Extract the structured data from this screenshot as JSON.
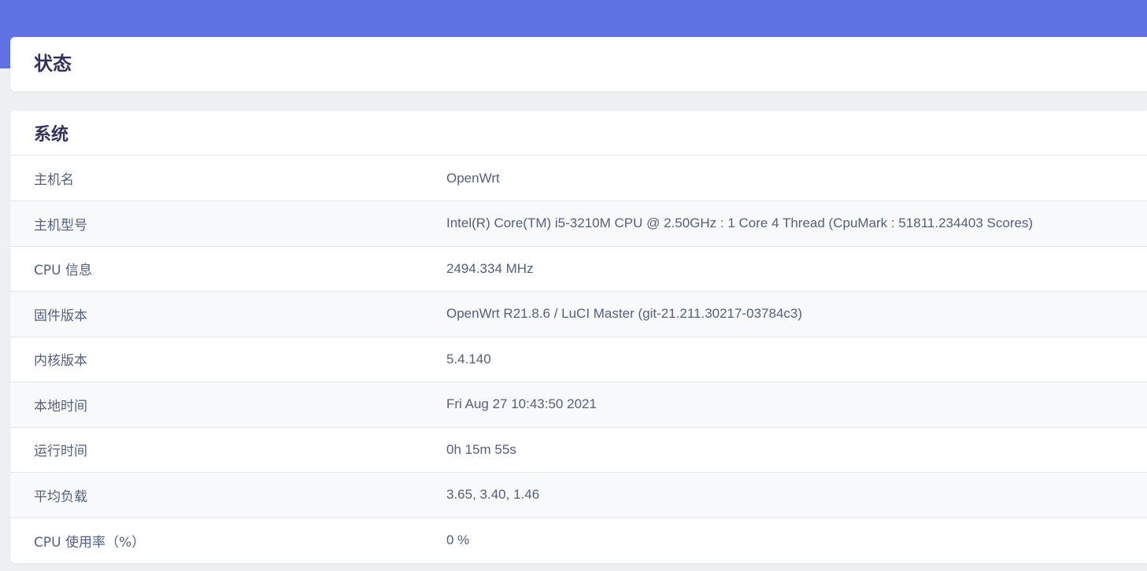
{
  "header": {
    "title": "状态"
  },
  "system": {
    "title": "系统",
    "rows": [
      {
        "label": "主机名",
        "value": "OpenWrt"
      },
      {
        "label": "主机型号",
        "value": "Intel(R) Core(TM) i5-3210M CPU @ 2.50GHz : 1 Core 4 Thread (CpuMark : 51811.234403 Scores)"
      },
      {
        "label": "CPU 信息",
        "value": "2494.334 MHz"
      },
      {
        "label": "固件版本",
        "value": "OpenWrt R21.8.6 / LuCI Master (git-21.211.30217-03784c3)"
      },
      {
        "label": "内核版本",
        "value": "5.4.140"
      },
      {
        "label": "本地时间",
        "value": "Fri Aug 27 10:43:50 2021"
      },
      {
        "label": "运行时间",
        "value": "0h 15m 55s"
      },
      {
        "label": "平均负载",
        "value": "3.65, 3.40, 1.46"
      },
      {
        "label": "CPU 使用率（%）",
        "value": "0 %"
      }
    ]
  },
  "colors": {
    "accent": "#5e72e4",
    "background": "#eef0f4",
    "heading": "#32325d",
    "text": "#525f7f"
  }
}
